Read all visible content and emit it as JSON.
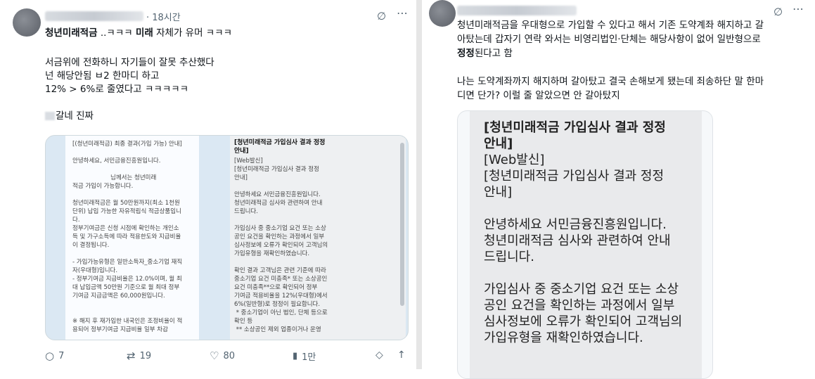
{
  "left": {
    "time": "· 18시간",
    "body_lines": [
      {
        "strong": "청년미래적금",
        "rest": " ..ㅋㅋㅋ ",
        "strong2": "미래",
        "rest2": " 자체가 유머 ㅋㅋㅋ"
      },
      "서금위에 전화하니 자기들이 잘못 추산했다",
      "넌 해당안됨 ㅂ2 한마디 하고",
      "12% > 6%로 줄였다고 ㅋㅋㅋㅋㅋ",
      "갈네 진짜"
    ],
    "media_left_text": "[(청년미래적금) 최종 결과(가입 가능) 안내]\n\n안녕하세요, 서민금융진흥원입니다.\n\n                    님께서는 청년미래\n적금 가입이 가능합니다.\n\n청년미래적금은 월 50만원까지(최소 1천원\n단위) 납입 가능한 자유적립식 적금상품입니\n다.\n정부기여금은 신청 시점에 확인하는 개인소\n득 및 가구소득에 따라 적용한도와 지급비율\n이 결정됩니다.\n\n- 가입가능유형은 일반소득자_중소기업 재직\n자(우대형)입니다.\n- 정부기여금 지급비율은 12.0%이며, 월 최\n대 납입금액 50만원 기준으로 월 최대 정부\n기여금 지급금액은 60,000원입니다.\n\n\n※ 해지 후 재가입한 내국인은 조정비율이 적\n용되어 정부기여금 지급비율 일부 차감\n\n※ 외국인은 정부기여금 없이 비과세 혜택만",
    "media_right_title": "[청년미래적금 가입심사 결과 정정\n안내]",
    "media_right_text": "[Web발신]\n[청년미래적금 가입심사 결과 정정\n안내]\n\n안녕하세요 서민금융진흥원입니다.\n청년미래적금 심사와 관련하여 안내\n드립니다.\n\n가입심사 중 중소기업 요건 또는 소상\n공인 요건을 확인하는 과정에서 일부\n심사정보에 오류가 확인되어 고객님의\n가입유형을 재확인하였습니다.\n\n확인 결과 고객님은 관련 기준에 따라\n중소기업 요건 미충족* 또는 소상공인\n요건 미충족**으로 확인되어 정부\n기여금 적용비율을 12%(우대형)에서\n6%(일반형)로 정정이 필요합니다.\n * 중소기업이 아닌 법인, 단체 등으로\n확인 등\n ** 소상공인 제외 업종이거나 운영",
    "actions": {
      "reply": "7",
      "repost": "19",
      "like": "80",
      "views": "1만"
    }
  },
  "right": {
    "line1": "청년미래적금을 우대형으로 가입할 수 있다고 해서 기존 도약계좌 해지하고 갈",
    "line2": "아탔는데 갑자기 연락 와서는 비영리법인·단체는 해당사항이 없어 일반형으로",
    "line3_strong": "정정",
    "line3_rest": "된다고 함",
    "line4": "나는 도약계좌까지 해지하며 갈아탔고 결국 손해보게 됐는데 죄송하단 말 한마",
    "line5": "디면 단가? 이럴 줄 알았으면 안 갈아탔지",
    "card_title": "[청년미래적금 가입심사 결과 정정\n안내]",
    "card_text": "[Web발신]\n[청년미래적금 가입심사 결과 정정\n안내]\n\n안녕하세요 서민금융진흥원입니다.\n청년미래적금 심사와 관련하여 안내\n드립니다.\n\n가입심사 중 중소기업 요건 또는 소상\n공인 요건을 확인하는 과정에서 일부\n심사정보에 오류가 확인되어 고객님의\n가입유형을 재확인하였습니다."
  },
  "icons": {
    "grok": "grok-icon",
    "more": "more-icon"
  },
  "colors": {
    "text": "#0f1419",
    "muted": "#536471"
  }
}
